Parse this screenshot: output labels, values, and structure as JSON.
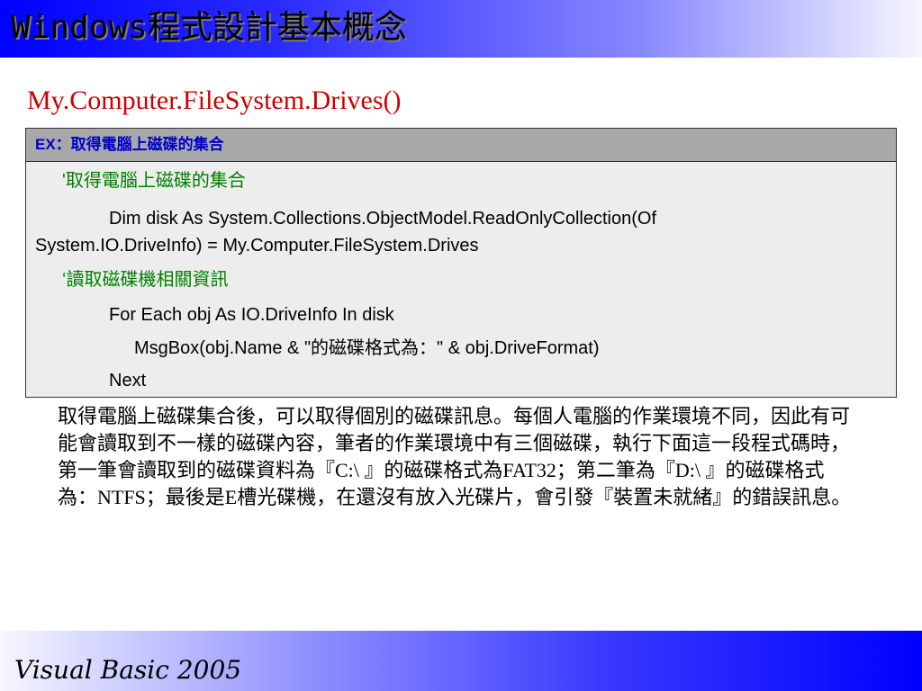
{
  "header": {
    "title": "Windows程式設計基本概念"
  },
  "subtitle": "My.Computer.FileSystem.Drives()",
  "code_box": {
    "header": "EX：取得電腦上磁碟的集合",
    "lines": [
      "'取得電腦上磁碟的集合",
      "Dim disk As System.Collections.ObjectModel.ReadOnlyCollection(Of",
      "System.IO.DriveInfo) = My.Computer.FileSystem.Drives",
      "‘讀取磁碟機相關資訊",
      "For Each obj As IO.DriveInfo In disk",
      "MsgBox(obj.Name & \"的磁碟格式為：\" & obj.DriveFormat)",
      "Next"
    ]
  },
  "paragraph": "取得電腦上磁碟集合後，可以取得個別的磁碟訊息。每個人電腦的作業環境不同，因此有可能會讀取到不一樣的磁碟內容，筆者的作業環境中有三個磁碟，執行下面這一段程式碼時，第一筆會讀取到的磁碟資料為『C:\\ 』的磁碟格式為FAT32；第二筆為『D:\\ 』的磁碟格式為：NTFS；最後是E槽光碟機，在還沒有放入光碟片，會引發『裝置未就緒』的錯誤訊息。",
  "footer": {
    "text": "Visual Basic 2005"
  },
  "colors": {
    "title_gradient_start": "#0000ff",
    "subtitle": "#cc0000",
    "code_header_bg": "#a8a8a8",
    "code_header_text": "#0000cc",
    "code_bg": "#ededed",
    "comment": "#008000"
  }
}
